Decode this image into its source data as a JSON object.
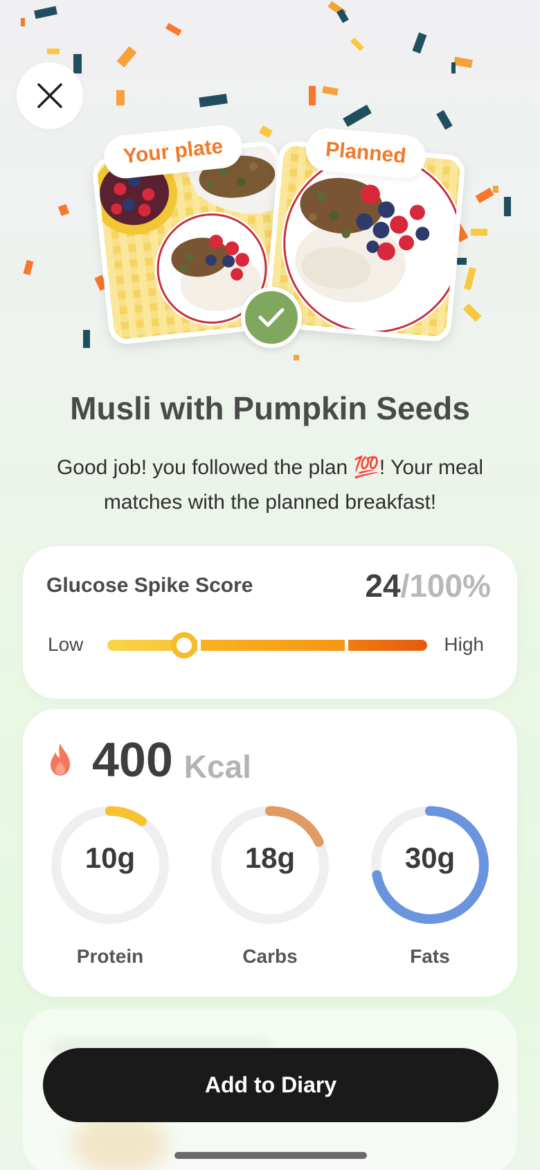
{
  "header": {
    "close_icon": "close-icon"
  },
  "comparison": {
    "left_tag": "Your plate",
    "right_tag": "Planned",
    "match_icon": "check-icon"
  },
  "meal": {
    "title": "Musli with Pumpkin Seeds",
    "message": "Good job! you followed the plan 💯! Your meal matches with the planned breakfast!"
  },
  "glucose": {
    "label": "Glucose Spike Score",
    "score": "24",
    "score_total": "/100%",
    "score_fraction": 0.24,
    "low_label": "Low",
    "high_label": "High"
  },
  "nutrition": {
    "flame_icon": "flame-icon",
    "kcal_value": "400",
    "kcal_unit": "Kcal",
    "macros": [
      {
        "value": "10g",
        "label": "Protein",
        "fraction": 0.1,
        "color": "#f6c132"
      },
      {
        "value": "18g",
        "label": "Carbs",
        "fraction": 0.18,
        "color": "#e09a62"
      },
      {
        "value": "30g",
        "label": "Fats",
        "fraction": 0.72,
        "color": "#6a95de"
      }
    ]
  },
  "actions": {
    "add_label": "Add to Diary"
  },
  "colors": {
    "accent_orange": "#f07a2a",
    "check_green": "#7fa85e",
    "button_dark": "#1a1a1a"
  }
}
